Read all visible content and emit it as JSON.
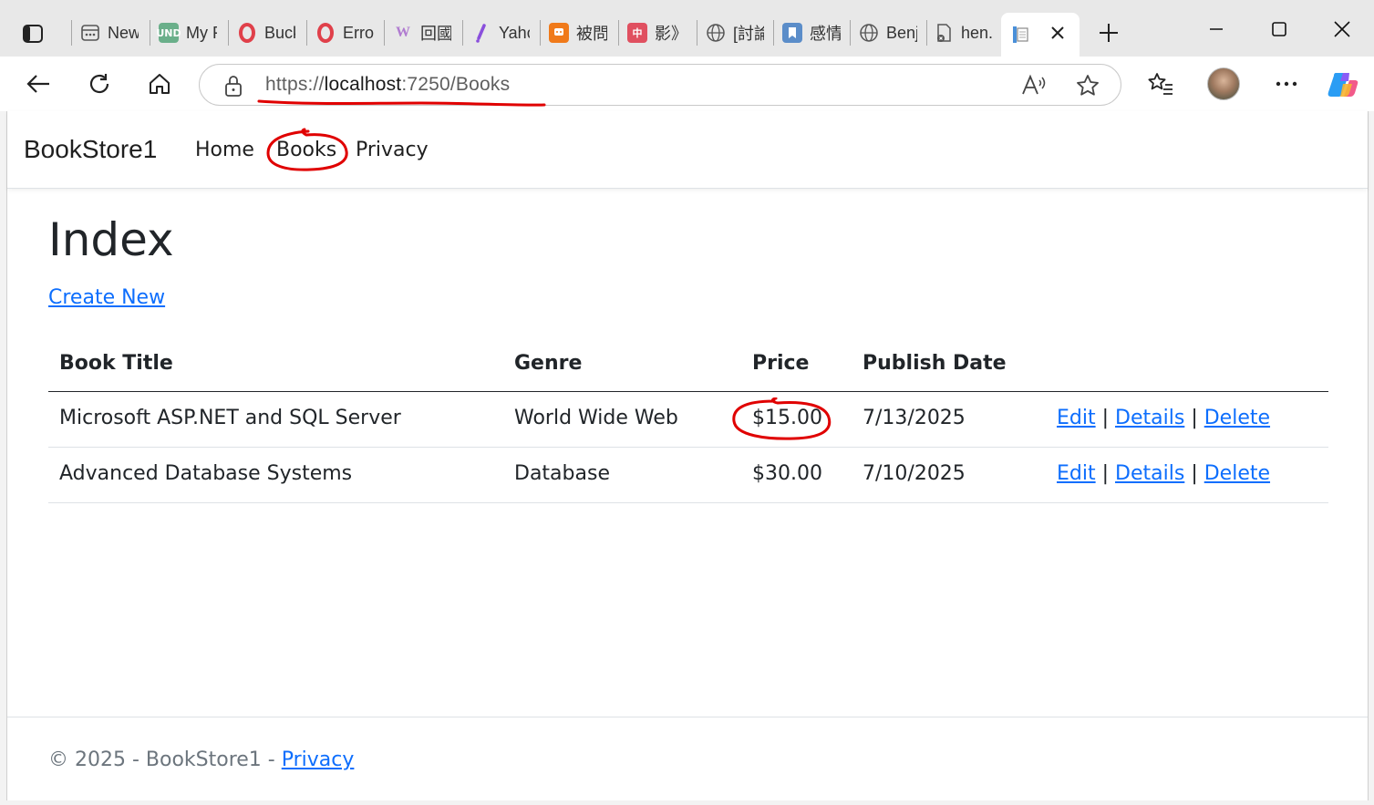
{
  "browser": {
    "tabs": [
      {
        "label": "New",
        "icon": "new-tab-page-icon",
        "color": "#ffffff"
      },
      {
        "label": "My F",
        "icon": "und-icon",
        "color": "#6aaf8a"
      },
      {
        "label": "Buck",
        "icon": "opera-icon",
        "color": "#e0404a"
      },
      {
        "label": "Erro",
        "icon": "opera-icon",
        "color": "#e0404a"
      },
      {
        "label": "回國",
        "icon": "w-logo-icon",
        "color": "#b07bd0"
      },
      {
        "label": "Yaho",
        "icon": "yahoo-icon",
        "color": "#8a4fdc"
      },
      {
        "label": "被問",
        "icon": "notify-icon",
        "color": "#f07a1a"
      },
      {
        "label": "影》t",
        "icon": "chinese-site-icon",
        "color": "#e05060"
      },
      {
        "label": "[討論",
        "icon": "globe-icon",
        "color": "#ffffff"
      },
      {
        "label": "感情",
        "icon": "bookmark-app-icon",
        "color": "#5b8dc9"
      },
      {
        "label": "Benj",
        "icon": "globe-icon",
        "color": "#ffffff"
      },
      {
        "label": "hen.",
        "icon": "broken-page-icon",
        "color": "#ffffff"
      }
    ],
    "active_tab": {
      "label": "",
      "icon": "document-icon"
    },
    "url_scheme": "https://",
    "url_host": "localhost",
    "url_rest": ":7250/Books"
  },
  "site": {
    "brand": "BookStore1",
    "nav": [
      "Home",
      "Books",
      "Privacy"
    ]
  },
  "page": {
    "title": "Index",
    "create_new": "Create New",
    "columns": [
      "Book Title",
      "Genre",
      "Price",
      "Publish Date"
    ],
    "rows": [
      {
        "title": "Microsoft ASP.NET and SQL Server",
        "genre": "World Wide Web",
        "price": "$15.00",
        "date": "7/13/2025"
      },
      {
        "title": "Advanced Database Systems",
        "genre": "Database",
        "price": "$30.00",
        "date": "7/10/2025"
      }
    ],
    "actions": {
      "edit": "Edit",
      "details": "Details",
      "delete": "Delete",
      "sep": "|"
    }
  },
  "footer": {
    "text": "© 2025 - BookStore1 - ",
    "link": "Privacy"
  },
  "annotation_color": "#e00000"
}
